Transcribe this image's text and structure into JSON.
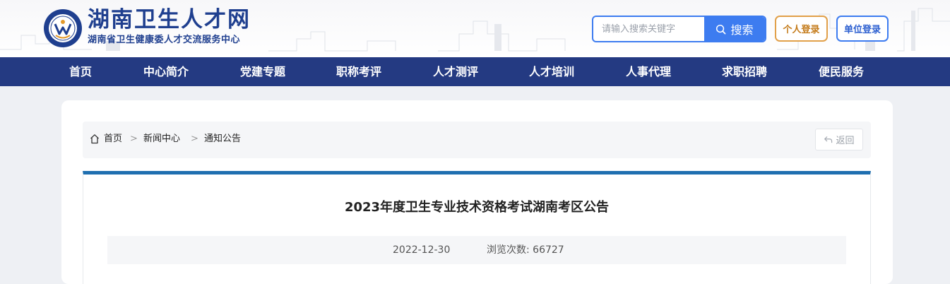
{
  "header": {
    "site_title": "湖南卫生人才网",
    "site_subtitle": "湖南省卫生健康委人才交流服务中心",
    "search": {
      "placeholder": "请输入搜索关键字",
      "button_label": "搜索"
    },
    "personal_login": "个人登录",
    "unit_login": "单位登录"
  },
  "nav": {
    "items": [
      {
        "label": "首页"
      },
      {
        "label": "中心简介"
      },
      {
        "label": "党建专题"
      },
      {
        "label": "职称考评"
      },
      {
        "label": "人才测评"
      },
      {
        "label": "人才培训"
      },
      {
        "label": "人事代理"
      },
      {
        "label": "求职招聘"
      },
      {
        "label": "便民服务"
      }
    ]
  },
  "breadcrumb": {
    "items": [
      {
        "label": "首页"
      },
      {
        "label": "新闻中心"
      },
      {
        "label": "通知公告"
      }
    ],
    "separator": ">",
    "back_label": "返回"
  },
  "article": {
    "title": "2023年度卫生专业技术资格考试湖南考区公告",
    "date": "2022-12-30",
    "views": "浏览次数: 66727"
  },
  "colors": {
    "brand_blue": "#1f3f8f",
    "nav_bg": "#243a82",
    "search_blue": "#3d7cf0",
    "personal_login_orange": "#e1a049",
    "article_accent": "#1f6fb0"
  },
  "icons": {
    "logo": "site-emblem",
    "search": "search-icon",
    "home": "home-icon",
    "back": "back-arrow-icon"
  }
}
